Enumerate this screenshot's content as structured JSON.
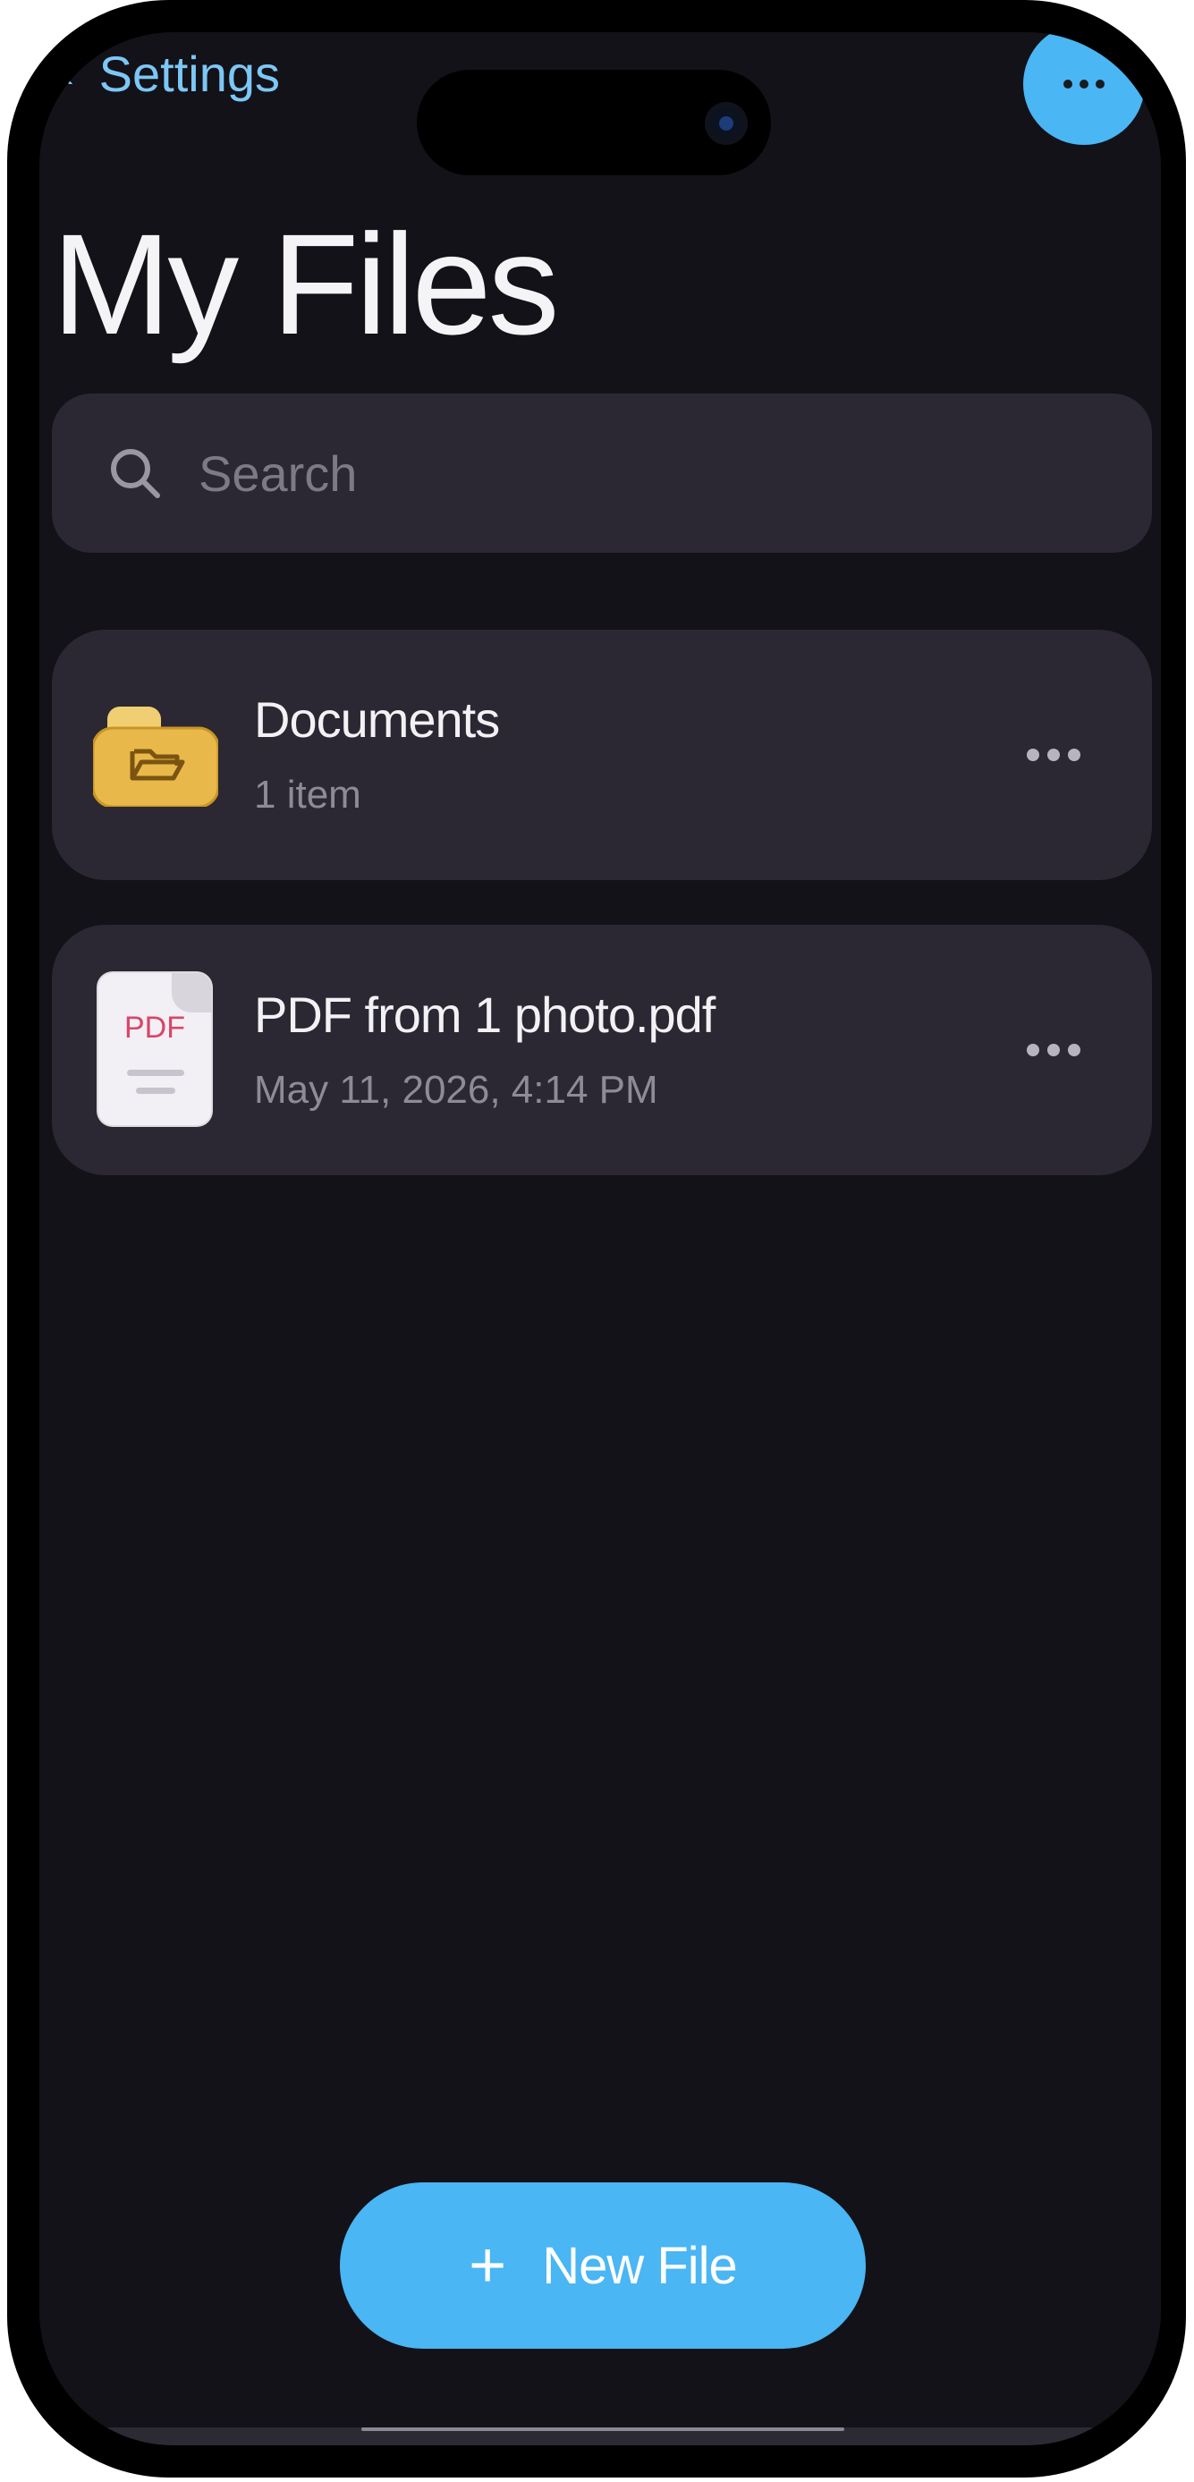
{
  "nav": {
    "back_label": "Settings"
  },
  "page": {
    "title": "My Files"
  },
  "search": {
    "placeholder": "Search"
  },
  "files": [
    {
      "title": "Documents",
      "subtitle": "1 item",
      "icon": "folder-icon"
    },
    {
      "title": "PDF from 1 photo.pdf",
      "subtitle": "May 11, 2026, 4:14 PM",
      "icon": "pdf-file-icon",
      "icon_text": "PDF"
    }
  ],
  "actions": {
    "new_file_label": "New File"
  },
  "colors": {
    "accent": "#4ab6f3",
    "back_link": "#7cc7f5",
    "background": "#131218",
    "card": "#2b2833",
    "folder": "#e8b94a",
    "pdf_label": "#d9456a"
  }
}
